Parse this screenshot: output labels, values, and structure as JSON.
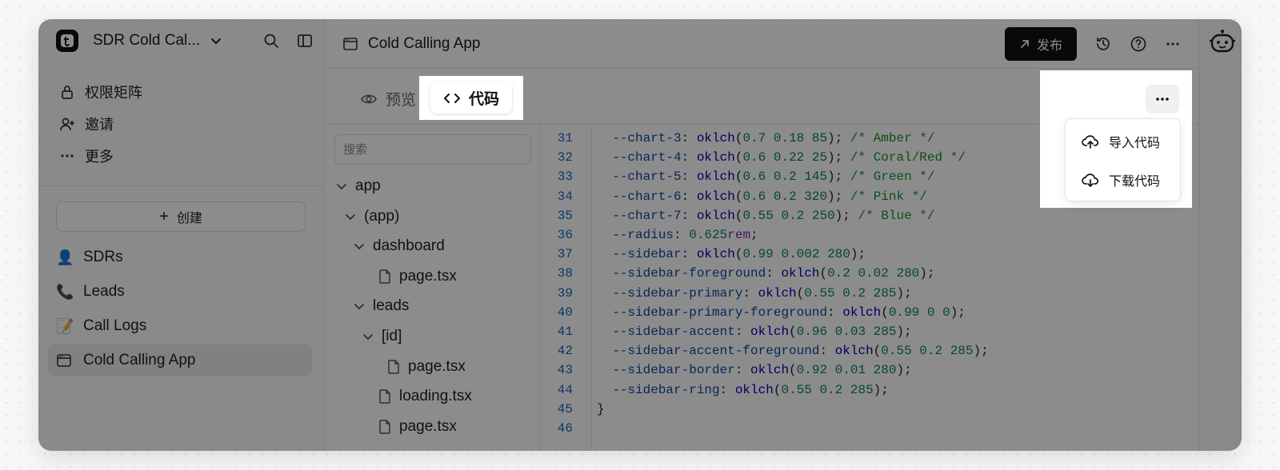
{
  "workspace": {
    "name": "SDR Cold Cal..."
  },
  "sidebar": {
    "nav": [
      {
        "label": "权限矩阵",
        "icon": "lock-icon"
      },
      {
        "label": "邀请",
        "icon": "user-plus-icon"
      },
      {
        "label": "更多",
        "icon": "more-horizontal-icon"
      }
    ],
    "create_label": "创建",
    "items": [
      {
        "emoji": "👤",
        "label": "SDRs"
      },
      {
        "emoji": "📞",
        "label": "Leads"
      },
      {
        "emoji": "📝",
        "label": "Call Logs"
      },
      {
        "emoji": "",
        "label": "Cold Calling App",
        "icon": "window-icon",
        "active": true
      }
    ]
  },
  "topbar": {
    "title": "Cold Calling App",
    "publish_label": "发布"
  },
  "tabs": {
    "preview_label": "预览",
    "code_label": "代码"
  },
  "filetree": {
    "search_placeholder": "搜索",
    "nodes": [
      {
        "label": "app",
        "type": "folder",
        "depth": 0
      },
      {
        "label": "(app)",
        "type": "folder",
        "depth": 1
      },
      {
        "label": "dashboard",
        "type": "folder",
        "depth": 2
      },
      {
        "label": "page.tsx",
        "type": "file",
        "depth": 3
      },
      {
        "label": "leads",
        "type": "folder",
        "depth": 2
      },
      {
        "label": "[id]",
        "type": "folder",
        "depth": 3
      },
      {
        "label": "page.tsx",
        "type": "file",
        "depth": 4
      },
      {
        "label": "loading.tsx",
        "type": "file",
        "depth": 3
      },
      {
        "label": "page.tsx",
        "type": "file",
        "depth": 3
      }
    ]
  },
  "editor": {
    "lines": [
      {
        "num": "31",
        "var": "--chart-3",
        "fn": "oklch",
        "args": "0.7 0.18 85",
        "comment": "/* Amber */"
      },
      {
        "num": "32",
        "var": "--chart-4",
        "fn": "oklch",
        "args": "0.6 0.22 25",
        "comment": "/* Coral/Red */"
      },
      {
        "num": "33",
        "var": "--chart-5",
        "fn": "oklch",
        "args": "0.6 0.2 145",
        "comment": "/* Green */"
      },
      {
        "num": "34",
        "var": "--chart-6",
        "fn": "oklch",
        "args": "0.6 0.2 320",
        "comment": "/* Pink */"
      },
      {
        "num": "35",
        "var": "--chart-7",
        "fn": "oklch",
        "args": "0.55 0.2 250",
        "comment": "/* Blue */"
      },
      {
        "num": "36",
        "var": "--radius",
        "num_value": "0.625",
        "unit": "rem"
      },
      {
        "num": "37",
        "var": "--sidebar",
        "fn": "oklch",
        "args": "0.99 0.002 280"
      },
      {
        "num": "38",
        "var": "--sidebar-foreground",
        "fn": "oklch",
        "args": "0.2 0.02 280"
      },
      {
        "num": "39",
        "var": "--sidebar-primary",
        "fn": "oklch",
        "args": "0.55 0.2 285"
      },
      {
        "num": "40",
        "var": "--sidebar-primary-foreground",
        "fn": "oklch",
        "args": "0.99 0 0"
      },
      {
        "num": "41",
        "var": "--sidebar-accent",
        "fn": "oklch",
        "args": "0.96 0.03 285"
      },
      {
        "num": "42",
        "var": "--sidebar-accent-foreground",
        "fn": "oklch",
        "args": "0.55 0.2 285"
      },
      {
        "num": "43",
        "var": "--sidebar-border",
        "fn": "oklch",
        "args": "0.92 0.01 280"
      },
      {
        "num": "44",
        "var": "--sidebar-ring",
        "fn": "oklch",
        "args": "0.55 0.2 285"
      },
      {
        "num": "45",
        "raw": "}"
      },
      {
        "num": "46",
        "raw": ""
      }
    ]
  },
  "menu": {
    "items": [
      {
        "label": "导入代码",
        "icon": "cloud-upload-icon"
      },
      {
        "label": "下载代码",
        "icon": "cloud-download-icon"
      }
    ]
  },
  "colors": {
    "accent": "#111111",
    "overlay": "rgba(0,0,0,0.45)",
    "line_number": "#1565c0"
  }
}
